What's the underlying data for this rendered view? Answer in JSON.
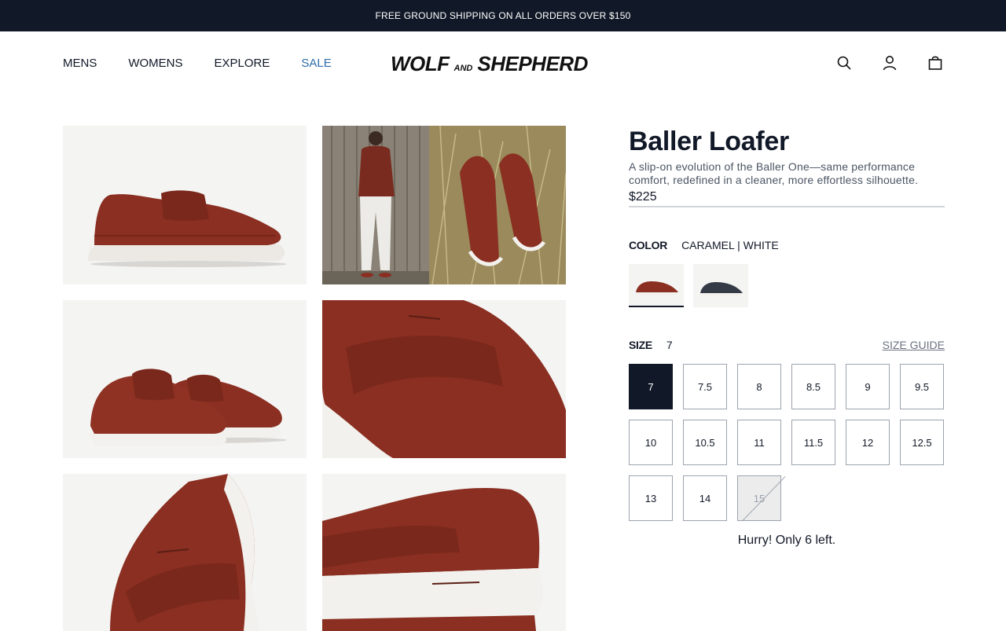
{
  "announcement": "FREE GROUND SHIPPING ON ALL ORDERS OVER $150",
  "nav": {
    "mens": "MENS",
    "womens": "WOMENS",
    "explore": "EXPLORE",
    "sale": "SALE"
  },
  "logo": {
    "left": "WOLF",
    "mid": "AND",
    "right": "SHEPHERD"
  },
  "icons": {
    "search": "search-icon",
    "account": "user-icon",
    "cart": "shopping-bag-icon"
  },
  "product": {
    "title": "Baller Loafer",
    "description": "A slip-on evolution of the Baller One—same performance comfort, redefined in a cleaner, more effortless silhouette.",
    "price": "$225"
  },
  "color": {
    "label": "COLOR",
    "value": "CARAMEL | WHITE"
  },
  "size": {
    "label": "SIZE",
    "selected": "7",
    "guide": "SIZE GUIDE",
    "options": [
      "7",
      "7.5",
      "8",
      "8.5",
      "9",
      "9.5",
      "10",
      "10.5",
      "11",
      "11.5",
      "12",
      "12.5",
      "13",
      "14",
      "15"
    ]
  },
  "stock": "Hurry! Only 6 left.",
  "colors": {
    "announce_bg": "#111827",
    "sale": "#2f6da8",
    "leather": "#8a2f21",
    "sole": "#f3f1ed"
  }
}
